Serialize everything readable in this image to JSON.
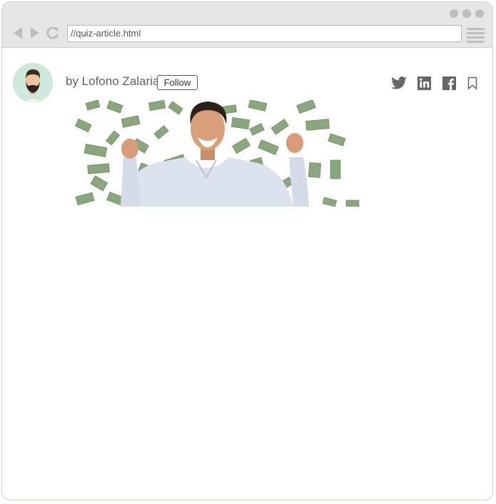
{
  "browser": {
    "url": "//quiz-article.html"
  },
  "article": {
    "author_line": "by Lofono Zalaria",
    "follow_label": "Follow"
  },
  "icons": {
    "back": "back-arrow-icon",
    "forward": "forward-arrow-icon",
    "reload": "reload-icon",
    "menu": "hamburger-menu-icon",
    "twitter": "twitter-icon",
    "linkedin": "linkedin-icon",
    "facebook": "facebook-icon",
    "bookmark": "bookmark-icon"
  },
  "colors": {
    "chrome_bg": "#e6e6e6",
    "icon_gray": "#666666",
    "money_green": "#7c9c6e"
  }
}
